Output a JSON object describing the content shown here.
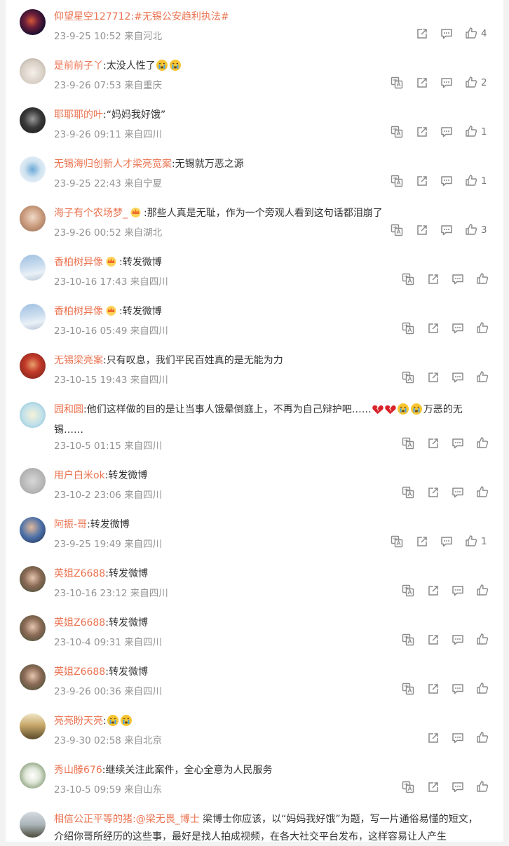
{
  "comments": [
    {
      "user": "仰望星空127712",
      "text": ":#无锡公安趋利执法#",
      "time": "23-9-25 10:52",
      "loc": "来自河北",
      "likes": "4"
    },
    {
      "user": "是前前子丫",
      "text": ":太没人性了",
      "time": "23-9-26 07:53",
      "loc": "来自重庆",
      "likes": "2"
    },
    {
      "user": "耶耶耶的叶",
      "text": ":“妈妈我好饿”",
      "time": "23-9-26 09:11",
      "loc": "来自四川",
      "likes": "1"
    },
    {
      "user": "无锡海归创新人才梁亮宽案",
      "text": ":无锡就万恶之源",
      "time": "23-9-25 22:43",
      "loc": "来自宁夏",
      "likes": "1"
    },
    {
      "user": "海子有个农场梦_",
      "text": ":那些人真是无耻，作为一个旁观人看到这句话都泪崩了",
      "time": "23-9-26 00:52",
      "loc": "来自湖北",
      "likes": "3"
    },
    {
      "user": "香柏树异像",
      "text": ":转发微博",
      "time": "23-10-16 17:43",
      "loc": "来自四川",
      "likes": ""
    },
    {
      "user": "香柏树异像",
      "text": ":转发微博",
      "time": "23-10-16 05:49",
      "loc": "来自四川",
      "likes": ""
    },
    {
      "user": "无锡梁亮案",
      "text": ":只有叹息，我们平民百姓真的是无能为力",
      "time": "23-10-15 19:43",
      "loc": "来自四川",
      "likes": ""
    },
    {
      "user": "园和圆",
      "text": ":他们这样做的目的是让当事人饿晕倒庭上，不再为自己辩护吧……",
      "text2": "万恶的无锡……",
      "time": "23-10-5 01:15",
      "loc": "来自四川",
      "likes": ""
    },
    {
      "user": "用户白米ok",
      "text": ":转发微博",
      "time": "23-10-2 23:06",
      "loc": "来自四川",
      "likes": ""
    },
    {
      "user": "阿振-哥",
      "text": ":转发微博",
      "time": "23-9-25 19:49",
      "loc": "来自四川",
      "likes": "1"
    },
    {
      "user": "英姐Z6688",
      "text": ":转发微博",
      "time": "23-10-16 23:12",
      "loc": "来自四川",
      "likes": ""
    },
    {
      "user": "英姐Z6688",
      "text": ":转发微博",
      "time": "23-10-4 09:31",
      "loc": "来自四川",
      "likes": ""
    },
    {
      "user": "英姐Z6688",
      "text": ":转发微博",
      "time": "23-9-26 00:36",
      "loc": "来自四川",
      "likes": ""
    },
    {
      "user": "亮亮盼天亮",
      "text": ":",
      "time": "23-9-30 02:58",
      "loc": "来自北京",
      "likes": ""
    },
    {
      "user": "秀山滕676",
      "text": ":继续关注此案件，全心全意为人民服务",
      "time": "23-10-5 09:59",
      "loc": "来自山东",
      "likes": ""
    },
    {
      "user": "相信公正平等的猪",
      "mention": ":@梁无畏_博士",
      "text": " 梁博士你应该，以“妈妈我好饿”为题，写一片通俗易懂的短文，介绍你哥所经历的这些事，最好是找人拍成视频，在各大社交平台发布，这样容易让人产生",
      "time": "",
      "loc": "",
      "likes": ""
    }
  ],
  "colors": {
    "username": "#eb7350",
    "meta": "#939393",
    "icon": "#8a8a8a"
  }
}
